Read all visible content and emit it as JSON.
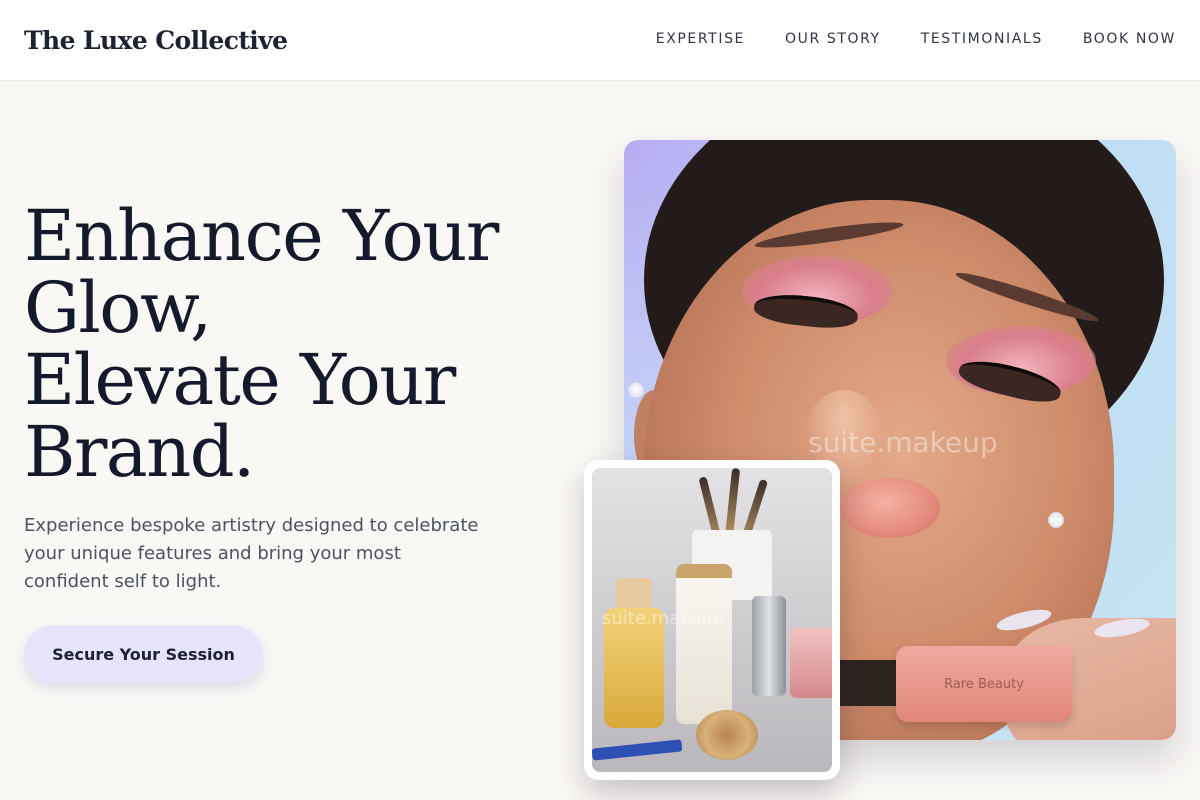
{
  "header": {
    "logo": "The Luxe Collective",
    "nav": [
      {
        "label": "EXPERTISE"
      },
      {
        "label": "OUR STORY"
      },
      {
        "label": "TESTIMONIALS"
      },
      {
        "label": "BOOK NOW"
      }
    ]
  },
  "hero": {
    "title_lines": [
      "Enhance Your",
      "Glow,",
      "Elevate Your",
      "Brand."
    ],
    "subtitle": "Experience bespoke artistry designed to celebrate your unique features and bring your most confident self to light.",
    "cta_label": "Secure Your Session"
  },
  "images": {
    "main_watermark": "suite.makeup",
    "product_label": "Rare Beauty",
    "inset_watermark": "suite.makeup"
  },
  "colors": {
    "page_background": "#faf8f5",
    "text_dark": "#141a2b",
    "text_muted": "#4b5264",
    "cta_background": "#e6e3fb"
  }
}
